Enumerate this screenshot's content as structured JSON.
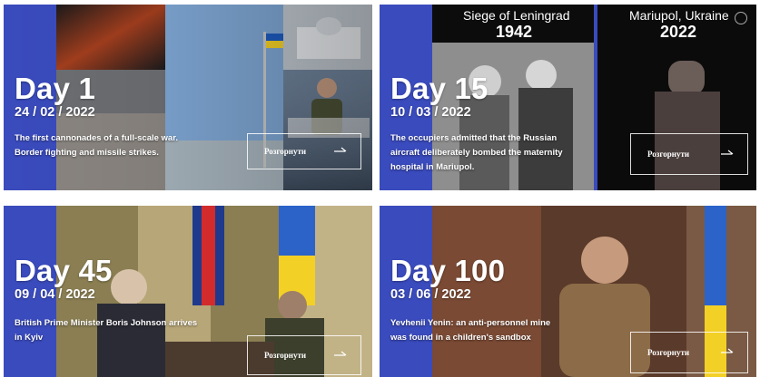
{
  "cards": [
    {
      "day": "Day 1",
      "date": "24 / 02 / 2022",
      "desc_line1": "The first cannonades of a full-scale war.",
      "desc_line2": "Border fighting and missile strikes.",
      "button": "Розгорнути",
      "icon": "arrow-right-icon"
    },
    {
      "day": "Day 15",
      "date": "10 / 03 / 2022",
      "caption_left_title": "Siege of Leningrad",
      "caption_left_year": "1942",
      "caption_right_title": "Mariupol, Ukraine",
      "caption_right_year": "2022",
      "desc_line1": "The occupiers admitted that the Russian",
      "desc_line2": "aircraft deliberately bombed the maternity",
      "desc_line3": "hospital in Mariupol.",
      "button": "Розгорнути",
      "icon": "arrow-right-icon"
    },
    {
      "day": "Day 45",
      "date": "09 / 04 / 2022",
      "desc_line1": "British Prime Minister Boris Johnson arrives",
      "desc_line2": "in Kyiv",
      "button": "Розгорнути",
      "icon": "arrow-right-icon"
    },
    {
      "day": "Day 100",
      "date": "03 / 06 / 2022",
      "desc_line1": "Yevhenii Yenin: an anti-personnel mine",
      "desc_line2": "was found in a children's sandbox",
      "button": "Розгорнути",
      "icon": "arrow-right-icon"
    }
  ],
  "colors": {
    "card_blue": "#3a4bbd",
    "text": "#ffffff"
  }
}
